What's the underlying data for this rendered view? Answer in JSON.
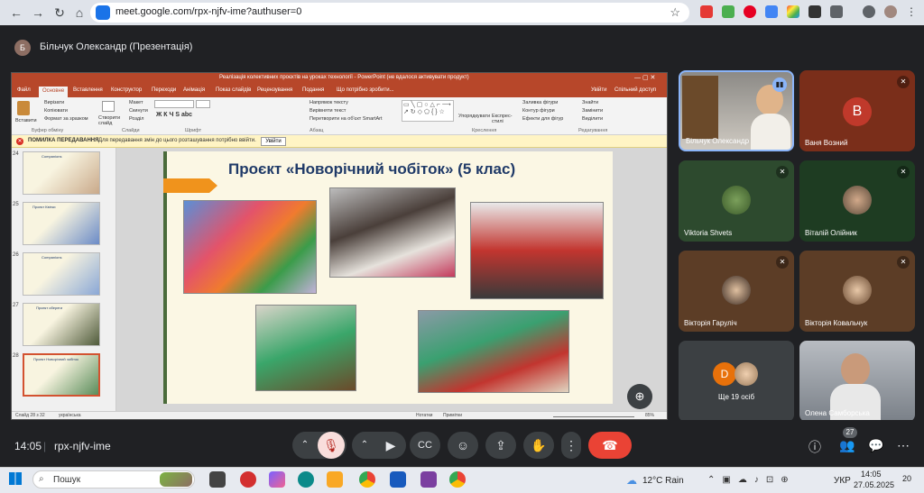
{
  "browser": {
    "url": "meet.google.com/rpx-njfv-ime?authuser=0"
  },
  "meet": {
    "presenter_initial": "Б",
    "presenter_title": "Більчук Олександр (Презентація)",
    "time": "14:05",
    "meeting_code": "rpx-njfv-ime",
    "participant_count": "27"
  },
  "ppt": {
    "window_title": "Реалізація колективних проєктів на уроках технології - PowerPoint (не вдалося активувати продукт)",
    "tabs": [
      "Файл",
      "Основне",
      "Вставлення",
      "Конструктор",
      "Переходи",
      "Анімація",
      "Показ слайдів",
      "Рецензування",
      "Подання"
    ],
    "tell_me": "Що потрібно зробити...",
    "sign_in": "Увійти",
    "share": "Спільний доступ",
    "ribbon": {
      "paste": "Вставити",
      "cut": "Вирізати",
      "copy": "Копіювати",
      "format_painter": "Формат за зразком",
      "clipboard": "Буфер обміну",
      "new_slide": "Створити слайд",
      "layout": "Макет",
      "reset": "Скинути",
      "section": "Розділ",
      "slides": "Слайди",
      "font": "Шрифт",
      "paragraph": "Абзац",
      "text_direction": "Напрямок тексту",
      "align_text": "Вирівняти текст",
      "smartart": "Перетворити на об'єкт SmartArt",
      "arrange": "Упорядкувати",
      "quick_styles": "Експрес-стилі",
      "shape_fill": "Заливка фігури",
      "shape_outline": "Контур фігури",
      "shape_effects": "Ефекти для фігур",
      "drawing": "Креслення",
      "find": "Знайти",
      "replace": "Замінити",
      "select": "Виділити",
      "editing": "Редагування"
    },
    "error_label": "ПОМИЛКА ПЕРЕДАВАННЯ",
    "error_text": "Для передавання змін до цього розташування потрібно ввійти.",
    "error_button": "Увійти",
    "thumbs": [
      {
        "num": "24",
        "caption": "Companions"
      },
      {
        "num": "25",
        "caption": "Проект Квітки"
      },
      {
        "num": "26",
        "caption": "Companions"
      },
      {
        "num": "27",
        "caption": "Проект обереги"
      },
      {
        "num": "28",
        "caption": "Проект Новорічний чобіток"
      }
    ],
    "slide_title": "Проєкт «Новорічний чобіток» (5 клас)",
    "status_slide": "Слайд 28 з 32",
    "status_lang": "українська",
    "status_notes": "Примітки",
    "status_comments": "Нотатки",
    "status_zoom": "85%"
  },
  "participants": [
    {
      "name": "Більчук Олександр",
      "initial": "",
      "color": "#6d6a63"
    },
    {
      "name": "Ваня Возний",
      "initial": "В",
      "color": "#7a2e1a"
    },
    {
      "name": "Viktoria Shvets",
      "initial": "",
      "color": "#2d4a2e"
    },
    {
      "name": "Віталій Олійник",
      "initial": "",
      "color": "#1e3c22"
    },
    {
      "name": "Вікторія Гаруліч",
      "initial": "",
      "color": "#5c3d26"
    },
    {
      "name": "Вікторія Ковальчук",
      "initial": "",
      "color": "#5c3d26"
    },
    {
      "name": "Ще 19 осіб",
      "initial": "D",
      "color": "#3c4043"
    },
    {
      "name": "Олена Самборська",
      "initial": "",
      "color": "#8a8f96"
    }
  ],
  "taskbar": {
    "search": "Пошук",
    "weather": "12°C  Rain",
    "lang": "УКР",
    "time": "14:05",
    "date": "27.05.2025",
    "notif": "20"
  },
  "colors": {
    "ppt_accent": "#b7472a",
    "meet_bg": "#202124",
    "hangup": "#ea4335",
    "mic_active": "#f9dedc"
  }
}
